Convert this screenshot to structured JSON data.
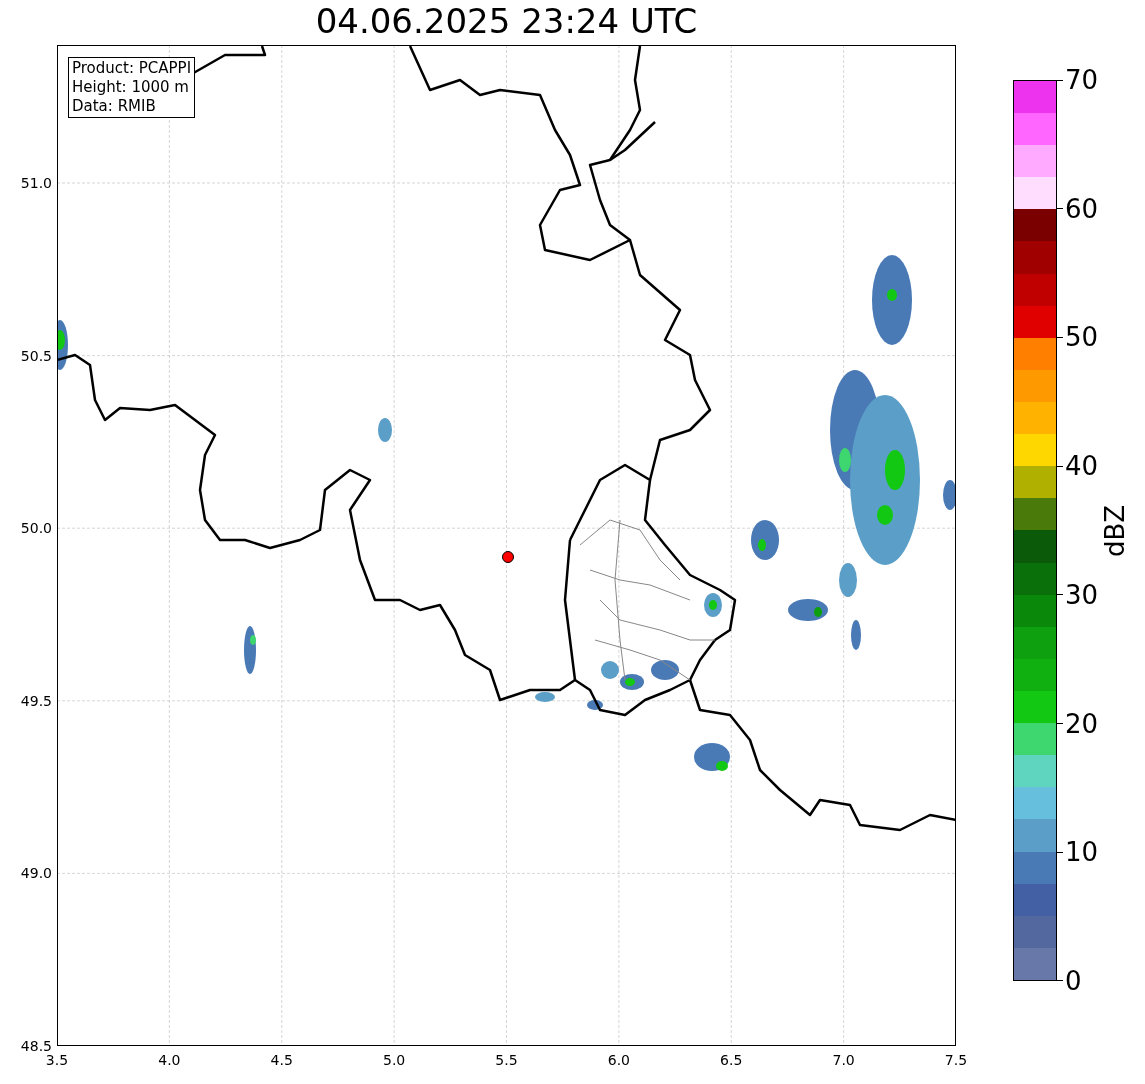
{
  "title": "04.06.2025 23:24 UTC",
  "info_box": {
    "lines": [
      "Product: PCAPPI",
      "Height: 1000 m",
      "Data: RMIB"
    ]
  },
  "map": {
    "xticks": [
      "3.5",
      "4.0",
      "4.5",
      "5.0",
      "5.5",
      "6.0",
      "6.5",
      "7.0",
      "7.5"
    ],
    "yticks": [
      "51.0",
      "50.5",
      "50.0",
      "49.5",
      "49.0",
      "48.5"
    ]
  },
  "colorbar": {
    "label": "dBZ",
    "ticks": [
      "70",
      "60",
      "50",
      "40",
      "30",
      "20",
      "10",
      "0"
    ],
    "bins": [
      {
        "color": "#6878a8"
      },
      {
        "color": "#5468a0"
      },
      {
        "color": "#4460a5"
      },
      {
        "color": "#4a7ab5"
      },
      {
        "color": "#5b9ec8"
      },
      {
        "color": "#66c0dd"
      },
      {
        "color": "#5fd5c0"
      },
      {
        "color": "#3ed66e"
      },
      {
        "color": "#12c812"
      },
      {
        "color": "#10b010"
      },
      {
        "color": "#0ea00e"
      },
      {
        "color": "#0a880a"
      },
      {
        "color": "#0a700a"
      },
      {
        "color": "#0a5a0a"
      },
      {
        "color": "#4a7a0a"
      },
      {
        "color": "#b0b000"
      },
      {
        "color": "#ffd700"
      },
      {
        "color": "#ffb300"
      },
      {
        "color": "#ff9900"
      },
      {
        "color": "#ff7f00"
      },
      {
        "color": "#e00000"
      },
      {
        "color": "#c00000"
      },
      {
        "color": "#a00000"
      },
      {
        "color": "#7a0000"
      },
      {
        "color": "#ffddff"
      },
      {
        "color": "#ffaaff"
      },
      {
        "color": "#ff66ff"
      },
      {
        "color": "#ee33ee"
      }
    ]
  }
}
